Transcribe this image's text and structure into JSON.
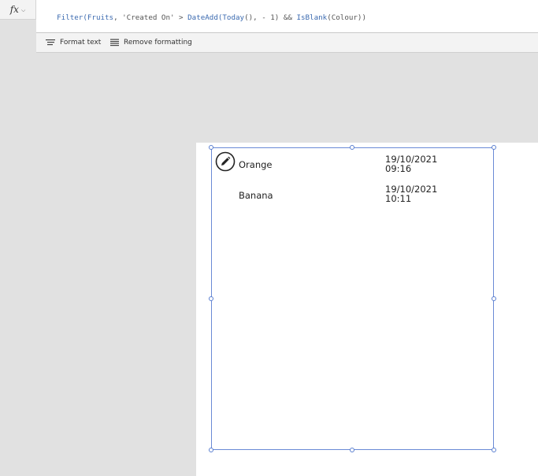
{
  "formula_bar": {
    "fx_label": "fx",
    "formula_tokens": [
      {
        "text": "Filter(",
        "kind": "fn"
      },
      {
        "text": "Fruits",
        "kind": "fn"
      },
      {
        "text": ", 'Created On' > ",
        "kind": "plain"
      },
      {
        "text": "DateAdd(",
        "kind": "fn"
      },
      {
        "text": "Today",
        "kind": "fn"
      },
      {
        "text": "(), - 1) && ",
        "kind": "plain"
      },
      {
        "text": "IsBlank",
        "kind": "fn"
      },
      {
        "text": "(Colour))",
        "kind": "plain"
      }
    ]
  },
  "format_bar": {
    "format_text_label": "Format text",
    "remove_formatting_label": "Remove formatting"
  },
  "gallery": {
    "items": [
      {
        "name": "Orange",
        "date_line1": "19/10/2021",
        "date_line2": "09:16"
      },
      {
        "name": "Banana",
        "date_line1": "19/10/2021",
        "date_line2": "10:11"
      }
    ]
  },
  "colors": {
    "selection_border": "#6a8ad6",
    "function_token": "#3b6ab0",
    "canvas_background": "#e1e1e1"
  },
  "icons": {
    "edit": "pencil-icon",
    "format_text": "format-text-icon",
    "remove_formatting": "remove-formatting-icon"
  }
}
